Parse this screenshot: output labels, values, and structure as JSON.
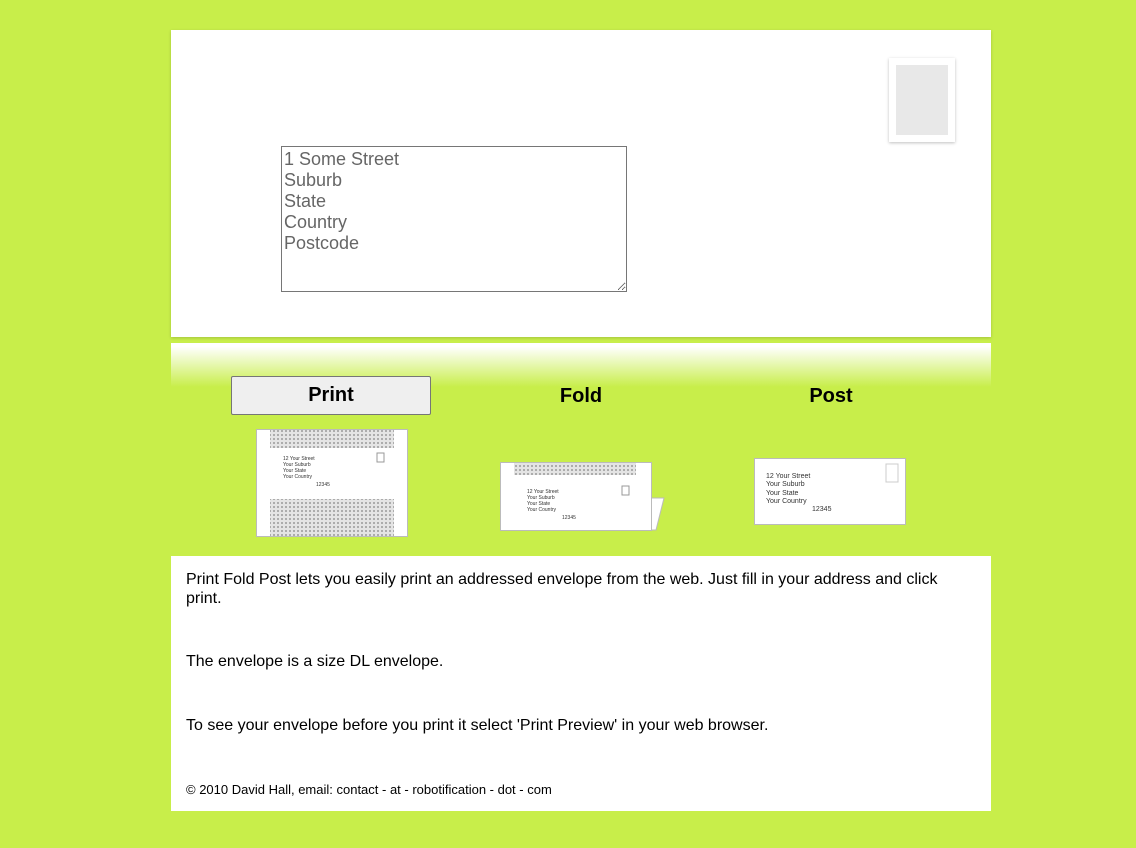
{
  "envelope": {
    "address_value": "1 Some Street\nSuburb\nState\nCountry\nPostcode"
  },
  "steps": {
    "print_label": "Print",
    "fold_label": "Fold",
    "post_label": "Post"
  },
  "sample_address": {
    "line1": "12 Your Street",
    "line2": "Your Suburb",
    "line3": "Your State",
    "line4": "Your Country",
    "postcode": "12345"
  },
  "info": {
    "paragraph1": "Print Fold Post lets you easily print an addressed envelope from the web. Just fill in your address and click print.",
    "paragraph2": "The envelope is a size DL envelope.",
    "paragraph3": "To see your envelope before you print it select 'Print Preview' in your web browser.",
    "footer": "© 2010 David Hall, email: contact - at - robotification - dot - com"
  },
  "colors": {
    "background": "#c8ee4a",
    "panel": "#ffffff",
    "stamp_fill": "#e8e8e8"
  },
  "icons": {
    "stamp": "postage-stamp-icon"
  }
}
